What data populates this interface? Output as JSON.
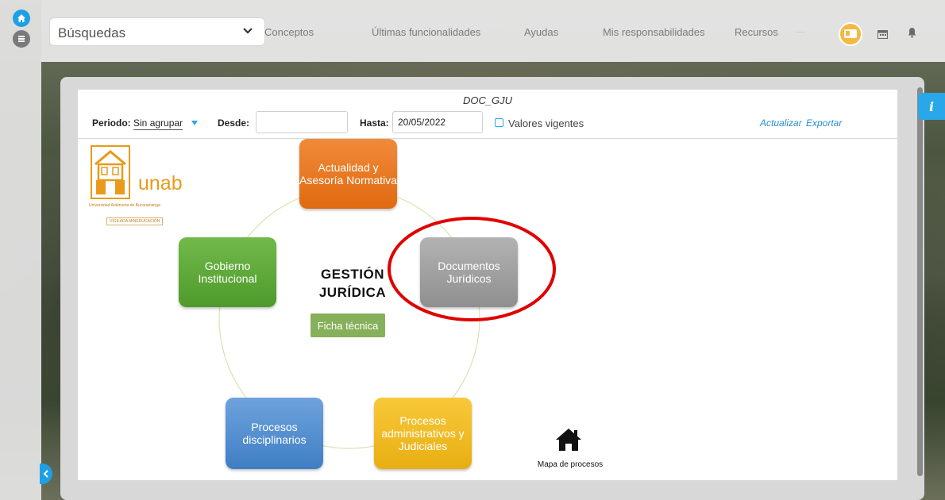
{
  "topbar": {
    "search_label": "Búsquedas",
    "nav": [
      "Conceptos",
      "Últimas funcionalidades",
      "Ayudas",
      "Mis responsabilidades",
      "Recursos"
    ]
  },
  "panel": {
    "doc_title": "DOC_GJU",
    "periodo_label": "Periodo:",
    "periodo_value": "Sin agrupar",
    "desde_label": "Desde:",
    "desde_value": "",
    "hasta_label": "Hasta:",
    "hasta_value": "20/05/2022",
    "vigentes_label": "Valores vigentes",
    "actualizar": "Actualizar",
    "exportar": "Exportar",
    "info_label": "i"
  },
  "diagram": {
    "logo_word": "unab",
    "logo_sub": "Universidad Autónoma de Bucaramanga",
    "logo_sub2": "VIGILADA MINEDUCACIÓN",
    "center_title": "GESTIÓN JURÍDICA",
    "ficha": "Ficha técnica",
    "boxes": {
      "actualidad": "Actualidad y Asesoría Normativa",
      "gobierno": "Gobierno Institucional",
      "documentos": "Documentos Jurídicos",
      "disciplinarios": "Procesos disciplinarios",
      "administrativos": "Procesos administrativos y Judiciales"
    },
    "mapa_label": "Mapa de procesos"
  },
  "colors": {
    "accent": "#1da1e6",
    "highlight_circle": "#e00000"
  }
}
